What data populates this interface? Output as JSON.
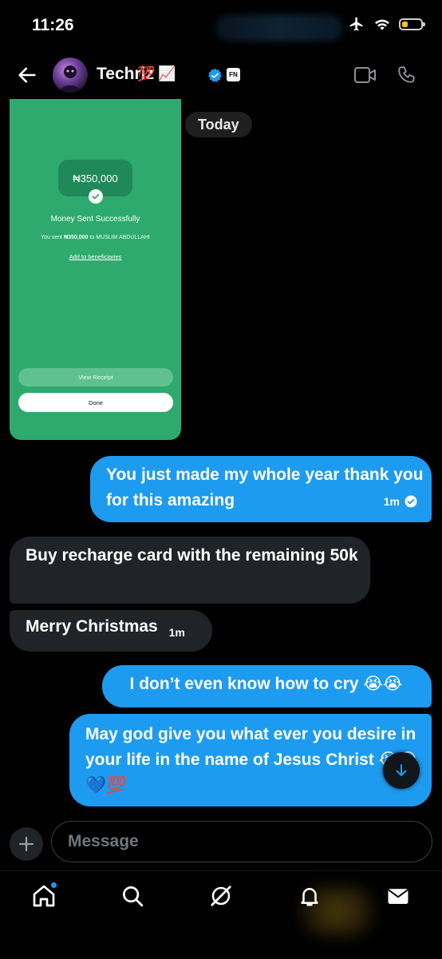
{
  "status_bar": {
    "time": "11:26"
  },
  "header": {
    "contact_name": "Techriz",
    "name_emojis": "💯📈",
    "badge_text": "FN"
  },
  "date_divider": "Today",
  "receipt_image": {
    "amount": "₦350,000",
    "title": "Money Sent Successfully",
    "subtitle_prefix": "You sent ",
    "subtitle_amount": "₦350,000",
    "subtitle_suffix": " to MUSLIM  ABDULLAHI",
    "link": "Add to beneficiaries",
    "view_receipt": "View Receipt",
    "done": "Done",
    "color": "#2eaa6f"
  },
  "messages": [
    {
      "direction": "out",
      "text": "You just made my whole year thank you for this amazing",
      "time": "1m",
      "read": true
    },
    {
      "direction": "in",
      "text": "Buy recharge card with the remaining 50k",
      "time": ""
    },
    {
      "direction": "in",
      "text": "Merry Christmas",
      "time": "1m"
    },
    {
      "direction": "out",
      "text": "I don’t even know how to cry 😭😭",
      "time": ""
    },
    {
      "direction": "out",
      "text": "May god give you what ever you desire in your life in the name of Jesus Christ 😭😭💙💯",
      "time": ""
    }
  ],
  "composer": {
    "placeholder": "Message"
  },
  "tabs": [
    "home-icon",
    "search-icon",
    "grok-icon",
    "notifications-icon",
    "messages-icon"
  ],
  "colors": {
    "accent": "#1d9bf0",
    "incoming": "#202327",
    "background": "#000000"
  }
}
